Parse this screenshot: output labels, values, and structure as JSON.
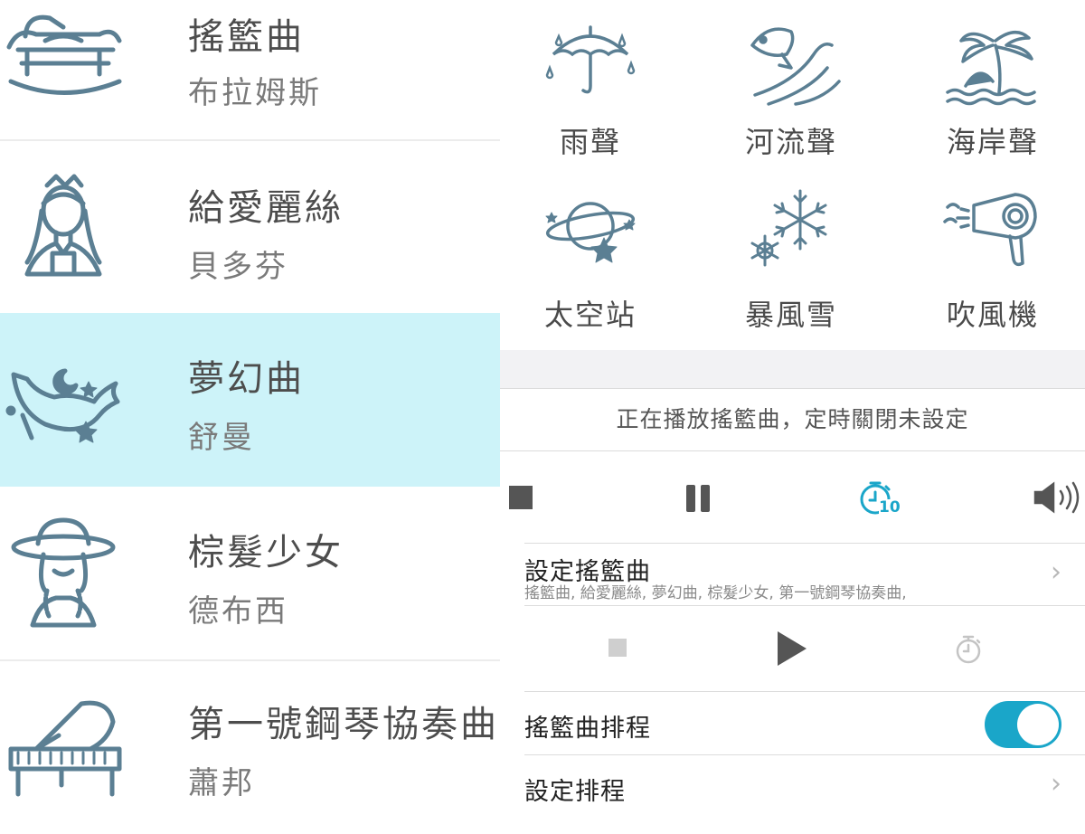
{
  "songs": [
    {
      "title": "搖籃曲",
      "composer": "布拉姆斯",
      "icon": "cradle-icon",
      "active": false
    },
    {
      "title": "給愛麗絲",
      "composer": "貝多芬",
      "icon": "girl-icon",
      "active": false
    },
    {
      "title": "夢幻曲",
      "composer": "舒曼",
      "icon": "whale-moon-icon",
      "active": true
    },
    {
      "title": "棕髮少女",
      "composer": "德布西",
      "icon": "girl-hat-icon",
      "active": false
    },
    {
      "title": "第一號鋼琴協奏曲",
      "composer": "蕭邦",
      "icon": "piano-icon",
      "active": false
    }
  ],
  "sounds": [
    {
      "label": "雨聲",
      "icon": "umbrella-rain-icon"
    },
    {
      "label": "河流聲",
      "icon": "fish-river-icon"
    },
    {
      "label": "海岸聲",
      "icon": "palm-beach-icon"
    },
    {
      "label": "太空站",
      "icon": "planet-icon"
    },
    {
      "label": "暴風雪",
      "icon": "snowflake-icon"
    },
    {
      "label": "吹風機",
      "icon": "hair-dryer-icon"
    }
  ],
  "status_text": "正在播放搖籃曲，定時關閉未設定",
  "controls": {
    "timer_badge": "10"
  },
  "lullaby_setting": {
    "title": "設定搖籃曲",
    "subtitle": "搖籃曲, 給愛麗絲, 夢幻曲, 棕髮少女, 第一號鋼琴協奏曲,"
  },
  "schedule": {
    "label": "搖籃曲排程",
    "enabled": true
  },
  "set_schedule": {
    "label": "設定排程"
  },
  "colors": {
    "icon": "#5b7f93",
    "accent": "#1aa6c9",
    "active_row": "#cdf3f9"
  }
}
